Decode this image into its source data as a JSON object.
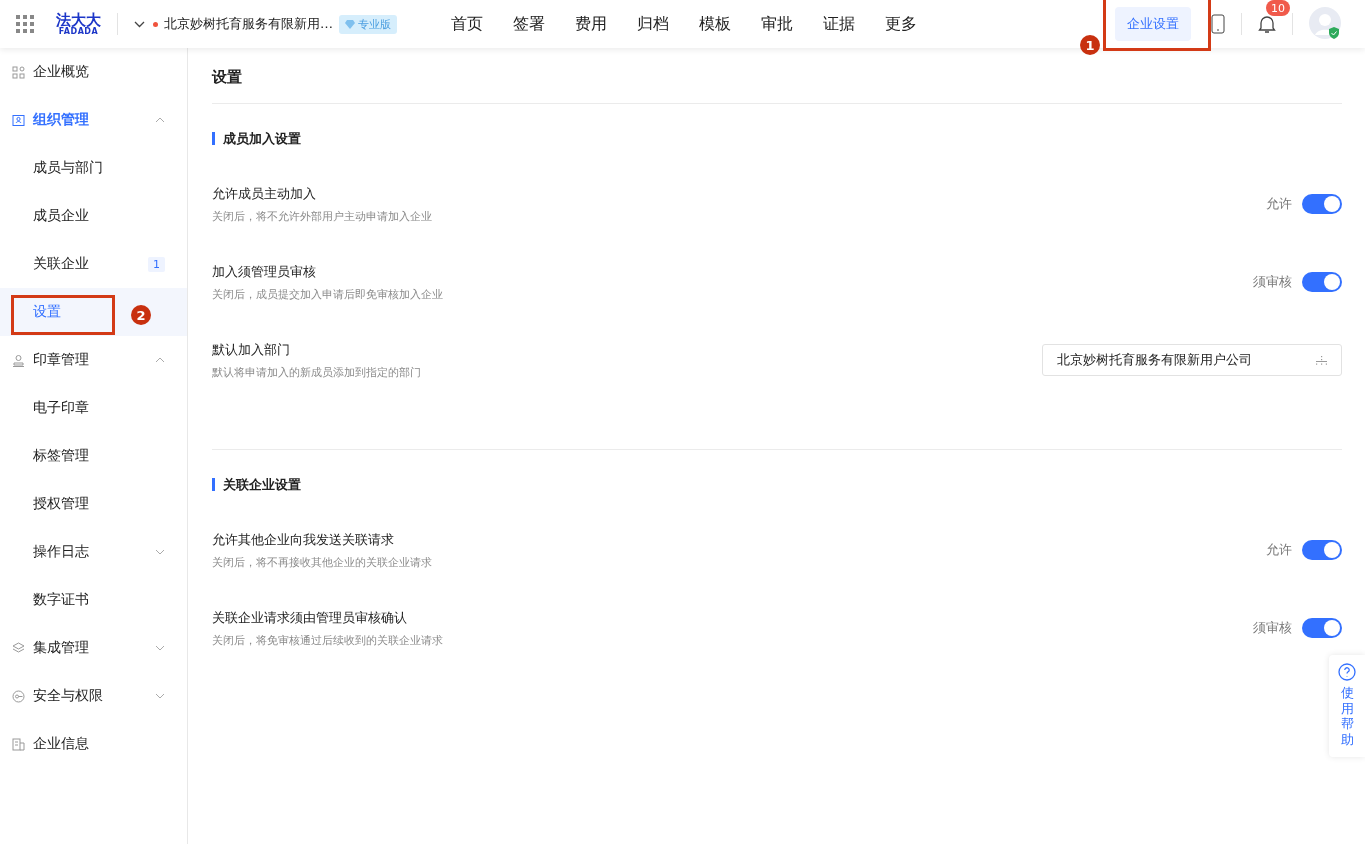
{
  "header": {
    "logo_cn": "法大大",
    "logo_en": "FADADA",
    "company": "北京妙树托育服务有限新用…",
    "edition": "专业版",
    "nav": [
      {
        "label": "首页",
        "selected": false
      },
      {
        "label": "签署",
        "selected": false
      },
      {
        "label": "费用",
        "selected": false
      },
      {
        "label": "归档",
        "selected": false
      },
      {
        "label": "模板",
        "selected": false
      },
      {
        "label": "审批",
        "selected": false
      },
      {
        "label": "证据",
        "selected": false
      },
      {
        "label": "更多",
        "selected": false
      }
    ],
    "settings_button": {
      "label": "企业设置",
      "selected": true,
      "annotation": "1"
    },
    "notification_count": "10"
  },
  "sidebar": {
    "items": [
      {
        "label": "企业概览",
        "selected": false
      },
      {
        "label": "组织管理",
        "selected": true,
        "expanded": true,
        "children": [
          {
            "label": "成员与部门",
            "selected": false
          },
          {
            "label": "成员企业",
            "selected": false
          },
          {
            "label": "关联企业",
            "selected": false,
            "badge": "1"
          },
          {
            "label": "设置",
            "selected": true,
            "annotation": "2"
          }
        ]
      },
      {
        "label": "印章管理",
        "selected": false,
        "expanded": true,
        "children": [
          {
            "label": "电子印章",
            "selected": false
          },
          {
            "label": "标签管理",
            "selected": false
          },
          {
            "label": "授权管理",
            "selected": false
          },
          {
            "label": "操作日志",
            "selected": false,
            "expanded": false
          },
          {
            "label": "数字证书",
            "selected": false
          }
        ]
      },
      {
        "label": "集成管理",
        "selected": false,
        "expanded": false
      },
      {
        "label": "安全与权限",
        "selected": false,
        "expanded": false
      },
      {
        "label": "企业信息",
        "selected": false
      }
    ]
  },
  "page": {
    "title": "设置",
    "sections": [
      {
        "title": "成员加入设置",
        "rows": [
          {
            "kind": "switch",
            "title": "允许成员主动加入",
            "description": "关闭后，将不允许外部用户主动申请加入企业",
            "status": "允许",
            "on": true
          },
          {
            "kind": "switch",
            "title": "加入须管理员审核",
            "description": "关闭后，成员提交加入申请后即免审核加入企业",
            "status": "须审核",
            "on": true
          },
          {
            "kind": "select",
            "title": "默认加入部门",
            "description": "默认将申请加入的新成员添加到指定的部门",
            "value": "北京妙树托育服务有限新用户公司"
          }
        ]
      },
      {
        "title": "关联企业设置",
        "rows": [
          {
            "kind": "switch",
            "title": "允许其他企业向我发送关联请求",
            "description": "关闭后，将不再接收其他企业的关联企业请求",
            "status": "允许",
            "on": true
          },
          {
            "kind": "switch",
            "title": "关联企业请求须由管理员审核确认",
            "description": "关闭后，将免审核通过后续收到的关联企业请求",
            "status": "须审核",
            "on": true
          }
        ]
      }
    ]
  },
  "help": {
    "label": "使用帮助"
  }
}
